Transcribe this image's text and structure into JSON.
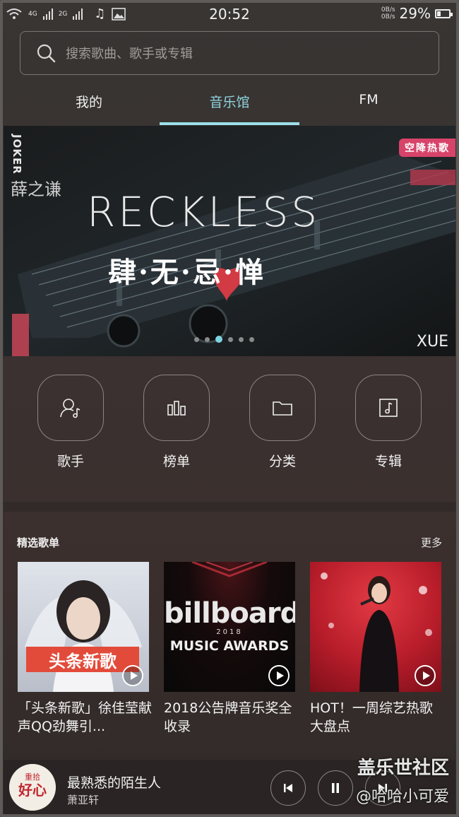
{
  "status": {
    "signal_labels": [
      "4G",
      "2G"
    ],
    "time": "20:52",
    "net_speed_up": "0B/s",
    "net_speed_down": "0B/s",
    "battery_percent": "29%",
    "battery_level": 0.29
  },
  "search": {
    "placeholder": "搜索歌曲、歌手或专辑"
  },
  "tabs": [
    {
      "label": "我的",
      "active": false
    },
    {
      "label": "音乐馆",
      "active": true
    },
    {
      "label": "FM",
      "active": false
    }
  ],
  "banner": {
    "vertical_text": "JOKER",
    "artist": "薛之谦",
    "title_en": "RECKLESS",
    "title_cn": "肆·无·忌·惮",
    "tag": "空降热歌",
    "brand": "XUE",
    "slide_count": 6,
    "active_slide": 3
  },
  "categories": [
    {
      "label": "歌手",
      "icon": "singer-icon"
    },
    {
      "label": "榜单",
      "icon": "chart-icon"
    },
    {
      "label": "分类",
      "icon": "folder-icon"
    },
    {
      "label": "专辑",
      "icon": "album-icon"
    }
  ],
  "playlists": {
    "title": "精选歌单",
    "more": "更多",
    "items": [
      {
        "title": "「头条新歌」徐佳莹献声QQ劲舞引...",
        "cover_text": "头条新歌"
      },
      {
        "title": " 2018公告牌音乐奖全收录",
        "cover_text_1": "billboard",
        "cover_text_2": "2018",
        "cover_text_3": "MUSIC AWARDS"
      },
      {
        "title": "HOT！一周综艺热歌大盘点"
      }
    ]
  },
  "player": {
    "song": "最熟悉的陌生人",
    "singer": "萧亚轩",
    "art_text": "重拾",
    "art_text_2": "好心"
  },
  "watermark": {
    "line1": "盖乐世社区",
    "line2": "@哈哈小可爱"
  },
  "colors": {
    "accent": "#8fd4de",
    "tag": "#d8436a"
  }
}
